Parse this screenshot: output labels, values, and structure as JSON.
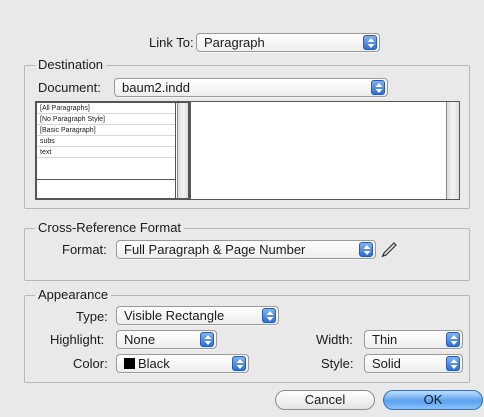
{
  "link_to": {
    "label": "Link To:",
    "value": "Paragraph"
  },
  "destination": {
    "title": "Destination",
    "document_label": "Document:",
    "document_value": "baum2.indd",
    "styles": [
      "[All Paragraphs]",
      "[No Paragraph Style]",
      "[Basic Paragraph]",
      "subs",
      "text"
    ]
  },
  "cross_reference": {
    "title": "Cross-Reference Format",
    "format_label": "Format:",
    "format_value": "Full Paragraph & Page Number"
  },
  "appearance": {
    "title": "Appearance",
    "type_label": "Type:",
    "type_value": "Visible Rectangle",
    "highlight_label": "Highlight:",
    "highlight_value": "None",
    "width_label": "Width:",
    "width_value": "Thin",
    "color_label": "Color:",
    "color_value": "Black",
    "style_label": "Style:",
    "style_value": "Solid"
  },
  "buttons": {
    "cancel": "Cancel",
    "ok": "OK"
  },
  "colors": {
    "accent": "#5aa2f0",
    "swatch": "#000000"
  },
  "icons": {
    "popup_arrows": "updown-arrows-icon",
    "edit_format": "pencil-icon"
  }
}
